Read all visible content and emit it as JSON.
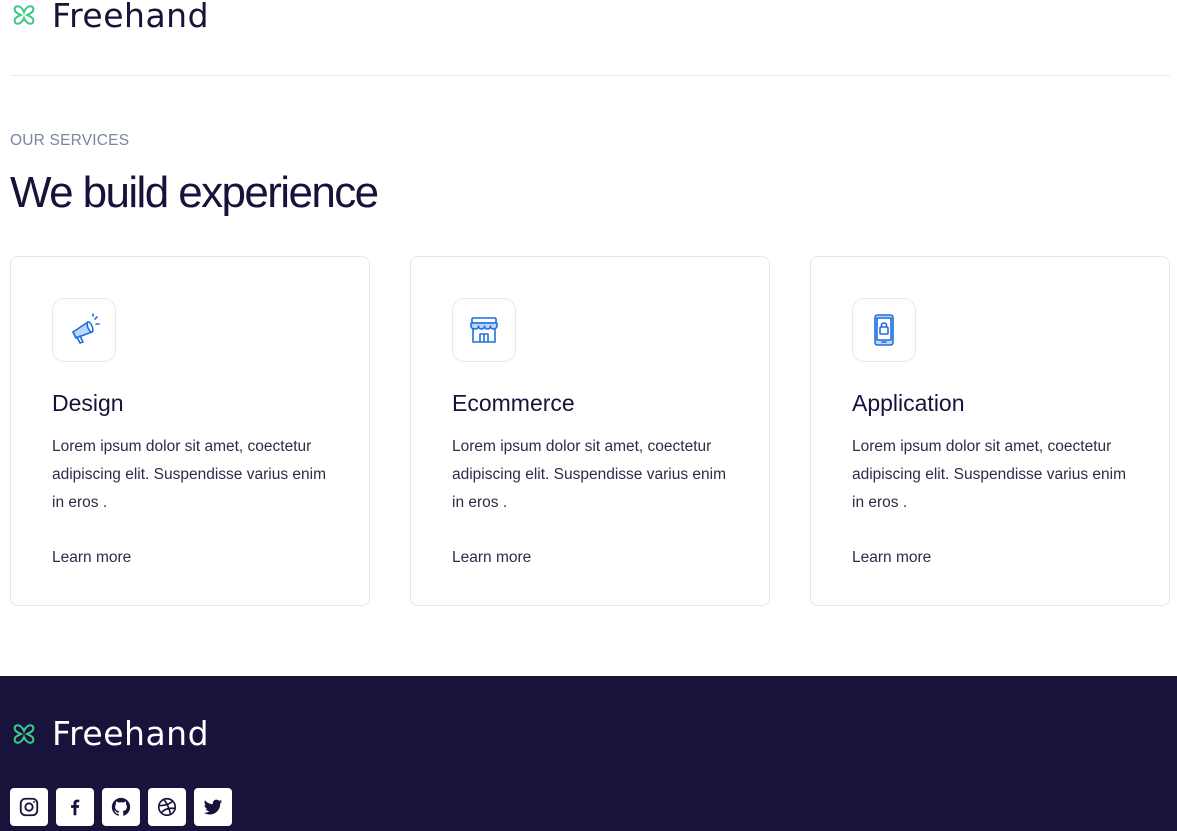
{
  "brand": {
    "name": "Freehand",
    "icon": "clover-icon",
    "accent": "#3cc98a"
  },
  "services": {
    "eyebrow": "OUR SERVICES",
    "heading": "We build experience",
    "cards": [
      {
        "icon": "megaphone-icon",
        "title": "Design",
        "text": "Lorem ipsum dolor sit amet, coectetur adipiscing elit. Suspendisse varius enim in eros .",
        "link": "Learn more"
      },
      {
        "icon": "storefront-icon",
        "title": "Ecommerce",
        "text": "Lorem ipsum dolor sit amet, coectetur adipiscing elit. Suspendisse varius enim in eros .",
        "link": "Learn more"
      },
      {
        "icon": "mobile-lock-icon",
        "title": "Application",
        "text": "Lorem ipsum dolor sit amet, coectetur adipiscing elit. Suspendisse varius enim in eros .",
        "link": "Learn more"
      }
    ]
  },
  "footer": {
    "brand_name": "Freehand",
    "background": "#17133b",
    "socials": [
      "instagram-icon",
      "facebook-icon",
      "github-icon",
      "dribbble-icon",
      "twitter-icon"
    ]
  }
}
